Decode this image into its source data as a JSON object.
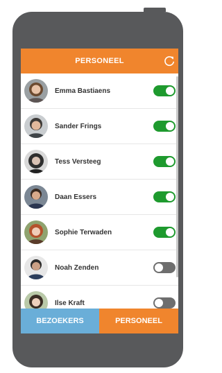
{
  "colors": {
    "phone_body": "#58595b",
    "accent_orange": "#f0852d",
    "accent_blue": "#6aaed8",
    "toggle_on": "#1e9a2e",
    "toggle_off": "#6e6e6e"
  },
  "header": {
    "title": "PERSONEEL",
    "refresh_icon": "refresh-icon"
  },
  "staff": [
    {
      "name": "Emma Bastiaens",
      "present": true,
      "avatar": "avatar-photo"
    },
    {
      "name": "Sander Frings",
      "present": true,
      "avatar": "avatar-photo"
    },
    {
      "name": "Tess Versteeg",
      "present": true,
      "avatar": "avatar-photo"
    },
    {
      "name": "Daan Essers",
      "present": true,
      "avatar": "avatar-photo"
    },
    {
      "name": "Sophie Terwaden",
      "present": true,
      "avatar": "avatar-photo"
    },
    {
      "name": "Noah Zenden",
      "present": false,
      "avatar": "avatar-photo"
    },
    {
      "name": "Ilse Kraft",
      "present": false,
      "avatar": "avatar-photo"
    }
  ],
  "nav": {
    "visitors_label": "BEZOEKERS",
    "staff_label": "PERSONEEL",
    "active": "staff"
  }
}
